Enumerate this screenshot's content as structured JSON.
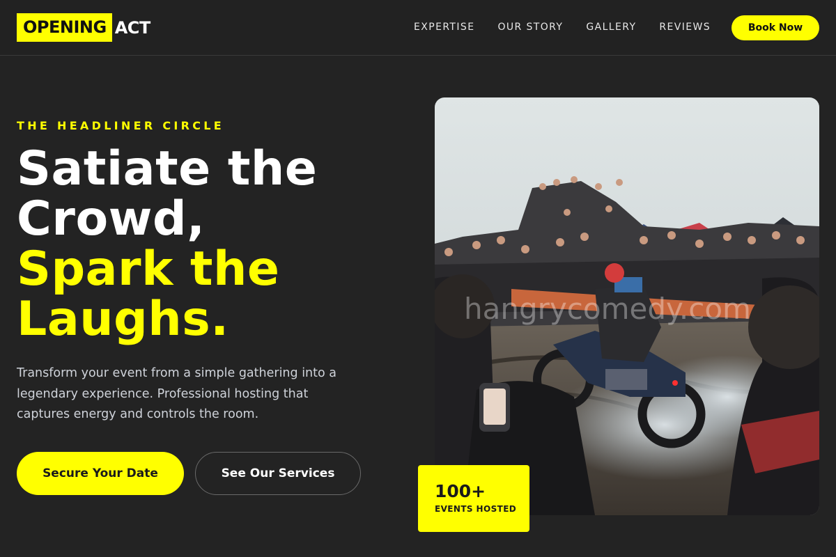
{
  "brand": {
    "logo_highlight": "OPENING",
    "logo_rest": "ACT",
    "accent_color": "#ffff00",
    "background_color": "#232323"
  },
  "nav": {
    "items": [
      {
        "label": "EXPERTISE"
      },
      {
        "label": "OUR STORY"
      },
      {
        "label": "GALLERY"
      },
      {
        "label": "REVIEWS"
      }
    ],
    "cta_label": "Book Now"
  },
  "hero": {
    "eyebrow": "THE HEADLINER CIRCLE",
    "headline_line1": "Satiate the",
    "headline_line2": "Crowd,",
    "headline_line3": "Spark the",
    "headline_line4": "Laughs.",
    "description": "Transform your event from a simple gathering into a legendary experience. Professional hosting that captures energy and controls the room.",
    "primary_button": "Secure Your Date",
    "secondary_button": "See Our Services"
  },
  "image": {
    "alt": "Crowd watching a motorcycle burnout",
    "watermark": "hangrycomedy.com"
  },
  "stat": {
    "value": "100+",
    "label": "EVENTS HOSTED"
  }
}
